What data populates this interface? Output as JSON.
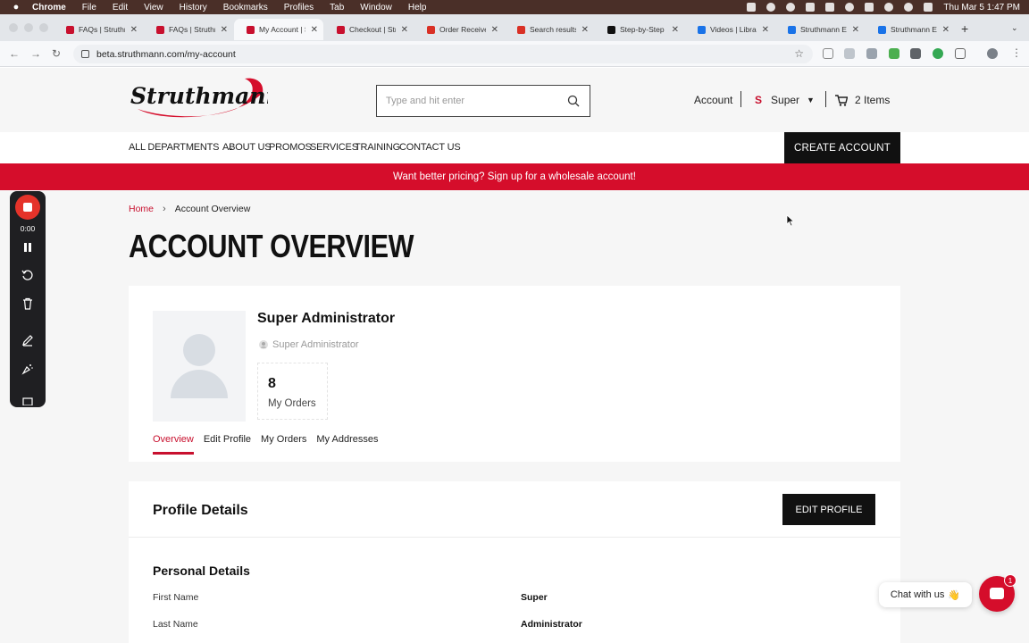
{
  "os_menubar": {
    "app_name": "Chrome",
    "menus": [
      "File",
      "Edit",
      "View",
      "History",
      "Bookmarks",
      "Profiles",
      "Tab",
      "Window",
      "Help"
    ],
    "datetime": "Thu Mar 5  1:47 PM"
  },
  "browser": {
    "tabs": [
      {
        "title": "FAQs | Struthmann",
        "icon": "struthmann-favicon",
        "active": false
      },
      {
        "title": "FAQs | Struthmann",
        "icon": "struthmann-favicon",
        "active": false
      },
      {
        "title": "My Account | Struthmann",
        "icon": "struthmann-favicon",
        "active": true
      },
      {
        "title": "Checkout | Struthmann",
        "icon": "struthmann-favicon",
        "active": false
      },
      {
        "title": "Order Received",
        "icon": "gmail-icon",
        "active": false
      },
      {
        "title": "Search results",
        "icon": "gmail-icon",
        "active": false
      },
      {
        "title": "Step-by-Step",
        "icon": "medium-icon",
        "active": false
      },
      {
        "title": "Videos | Library",
        "icon": "doc-icon",
        "active": false
      },
      {
        "title": "Struthmann E",
        "icon": "doc-icon",
        "active": false
      },
      {
        "title": "Struthmann E",
        "icon": "doc-icon",
        "active": false
      }
    ],
    "url": "beta.struthmann.com/my-account"
  },
  "header": {
    "logo_text": "Struthmann",
    "search_placeholder": "Type and hit enter",
    "account_label": "Account",
    "user_initial": "S",
    "user_label": "Super",
    "cart_label": "2 Items"
  },
  "nav": {
    "items": [
      "ALL DEPARTMENTS",
      "ABOUT US",
      "PROMOS",
      "SERVICES",
      "TRAINING",
      "CONTACT US"
    ],
    "create_account": "CREATE ACCOUNT"
  },
  "promo_text": "Want better pricing? Sign up for a wholesale account!",
  "breadcrumb": {
    "home": "Home",
    "current": "Account Overview"
  },
  "page_title": "ACCOUNT OVERVIEW",
  "profile": {
    "name": "Super Administrator",
    "role": "Super Administrator",
    "orders_count": "8",
    "orders_label": "My Orders",
    "tabs": [
      "Overview",
      "Edit Profile",
      "My Orders",
      "My Addresses"
    ],
    "active_tab": "Overview"
  },
  "profile_details": {
    "title": "Profile Details",
    "edit_button": "EDIT PROFILE",
    "personal_title": "Personal Details",
    "fields": [
      {
        "label": "First Name",
        "value": "Super"
      },
      {
        "label": "Last Name",
        "value": "Administrator"
      }
    ]
  },
  "recorder": {
    "time": "0:00"
  },
  "chat": {
    "label": "Chat with us",
    "badge": "1"
  },
  "colors": {
    "brand_red": "#d50d2b",
    "dark": "#111111"
  }
}
